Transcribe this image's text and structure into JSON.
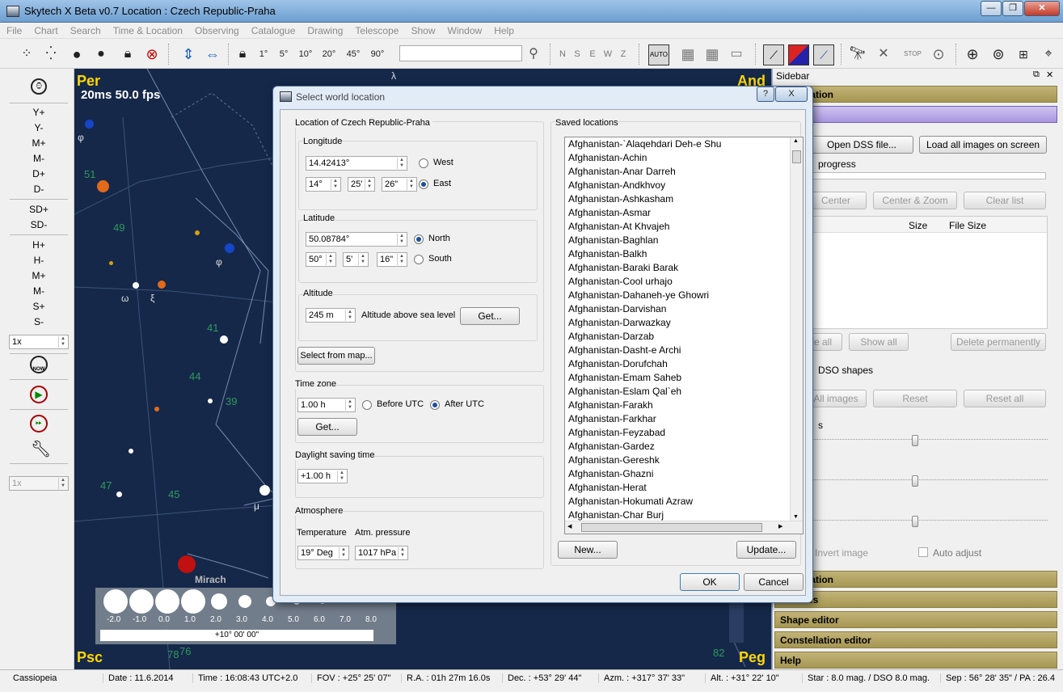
{
  "window": {
    "title": "Skytech X Beta v0.7   Location : Czech Republic-Praha"
  },
  "menu": [
    "File",
    "Chart",
    "Search",
    "Time & Location",
    "Observing",
    "Catalogue",
    "Drawing",
    "Telescope",
    "Show",
    "Window",
    "Help"
  ],
  "toolbar": {
    "fov_buttons": [
      "1°",
      "5°",
      "10°",
      "20°",
      "45°",
      "90°"
    ],
    "directions": [
      "N",
      "S",
      "E",
      "W",
      "Z"
    ],
    "auto_label": "AUTO",
    "stop_label": "STOP",
    "search_value": ""
  },
  "left_panel": {
    "buttons": [
      "Y+",
      "Y-",
      "M+",
      "M-",
      "D+",
      "D-",
      "SD+",
      "SD-",
      "H+",
      "H-",
      "M+",
      "M-",
      "S+",
      "S-"
    ],
    "speed1": "1x",
    "speed2": "1x",
    "now_label": "NOW"
  },
  "sky": {
    "corner_tl": "Per",
    "corner_tr": "And",
    "corner_bl": "Psc",
    "corner_br": "Peg",
    "fps": "20ms 50.0 fps",
    "labels": [
      "51",
      "49",
      "41",
      "44",
      "39",
      "47",
      "45",
      "φ",
      "φ",
      "ω",
      "ξ",
      "μ",
      "λ",
      "78",
      "76",
      "82"
    ],
    "mirach": "Mirach",
    "mag_scale": [
      "-2.0",
      "-1.0",
      "0.0",
      "1.0",
      "2.0",
      "3.0",
      "4.0",
      "5.0",
      "6.0",
      "7.0",
      "8.0"
    ],
    "scale_bar": "+10° 00' 00\""
  },
  "sidebar": {
    "title": "Sidebar",
    "sections": [
      "Information",
      "Images",
      "Information",
      "Pictures",
      "Shape editor",
      "Constellation editor",
      "Help"
    ],
    "open_dss": "Open DSS file...",
    "load_all": "Load all images on screen",
    "progress": "progress",
    "center": "Center",
    "center_zoom": "Center & Zoom",
    "clear_list": "Clear list",
    "col_size": "Size",
    "col_file_size": "File Size",
    "hide_all": "Hide all",
    "show_all": "Show all",
    "delete_perm": "Delete permanently",
    "dso_shapes": "DSO shapes",
    "all_images": "All images",
    "reset": "Reset",
    "reset_all": "Reset all",
    "s_label": "s",
    "invert_image": "Invert image",
    "auto_adjust": "Auto adjust",
    "slider_levels": [
      0.47,
      0.47,
      0.47
    ]
  },
  "dialog": {
    "title": "Select world location",
    "location_group": "Location of Czech Republic-Praha",
    "longitude_label": "Longitude",
    "longitude": "14.42413°",
    "lon_d": "14°",
    "lon_m": "25'",
    "lon_s": "26\"",
    "west": "West",
    "east": "East",
    "latitude_label": "Latitude",
    "latitude": "50.08784°",
    "lat_d": "50°",
    "lat_m": "5'",
    "lat_s": "16\"",
    "north": "North",
    "south": "South",
    "altitude_label": "Altitude",
    "altitude": "245 m",
    "altitude_desc": "Altitude above sea level",
    "get1": "Get...",
    "select_map": "Select from map...",
    "tz_label": "Time zone",
    "tz": "1.00 h",
    "before_utc": "Before UTC",
    "after_utc": "After UTC",
    "get2": "Get...",
    "dst_label": "Daylight saving time",
    "dst": "+1.00 h",
    "atm_label": "Atmosphere",
    "temp_label": "Temperature",
    "press_label": "Atm. pressure",
    "temp": "19° Deg",
    "press": "1017 hPa",
    "saved_label": "Saved locations",
    "locations": [
      "Afghanistan-`Alaqehdari Deh-e Shu",
      "Afghanistan-Achin",
      "Afghanistan-Anar Darreh",
      "Afghanistan-Andkhvoy",
      "Afghanistan-Ashkasham",
      "Afghanistan-Asmar",
      "Afghanistan-At Khvajeh",
      "Afghanistan-Baghlan",
      "Afghanistan-Balkh",
      "Afghanistan-Baraki Barak",
      "Afghanistan-Cool urhajo",
      "Afghanistan-Dahaneh-ye Ghowri",
      "Afghanistan-Darvishan",
      "Afghanistan-Darwazkay",
      "Afghanistan-Darzab",
      "Afghanistan-Dasht-e Archi",
      "Afghanistan-Dorufchah",
      "Afghanistan-Emam Saheb",
      "Afghanistan-Eslam Qal`eh",
      "Afghanistan-Farakh",
      "Afghanistan-Farkhar",
      "Afghanistan-Feyzabad",
      "Afghanistan-Gardez",
      "Afghanistan-Gereshk",
      "Afghanistan-Ghazni",
      "Afghanistan-Herat",
      "Afghanistan-Hokumati Azraw",
      "Afghanistan-Char Burj"
    ],
    "new": "New...",
    "update": "Update...",
    "ok": "OK",
    "cancel": "Cancel",
    "help": "?",
    "close": "X"
  },
  "status": {
    "constellation": "Cassiopeia",
    "date": "Date : 11.6.2014",
    "time": "Time : 16:08:43 UTC+2.0",
    "fov": "FOV : +25° 25' 07\"",
    "ra": "R.A. : 01h 27m 16.0s",
    "dec": "Dec. : +53° 29' 44\"",
    "azm": "Azm. : +317° 37' 33\"",
    "alt": "Alt. : +31° 22' 10\"",
    "mag": "Star : 8.0 mag. / DSO 8.0 mag.",
    "sep": "Sep : 56° 28' 35\" / PA : 26.4"
  }
}
